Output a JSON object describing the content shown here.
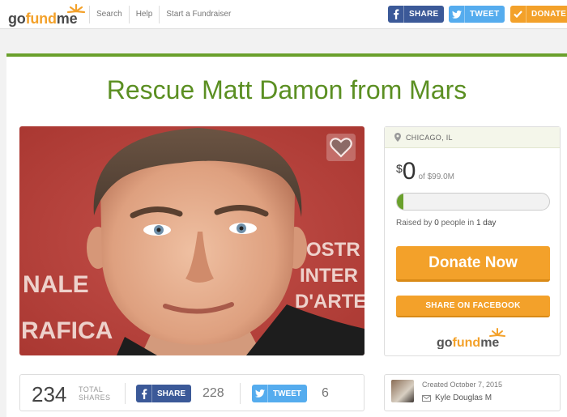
{
  "header": {
    "logo": {
      "go": "go",
      "fund": "fund",
      "me": "me"
    },
    "nav": [
      "Search",
      "Help",
      "Start a Fundraiser"
    ],
    "share_label": "SHARE",
    "tweet_label": "TWEET",
    "donate_label": "DONATE"
  },
  "campaign": {
    "title": "Rescue Matt Damon from Mars",
    "location": "CHICAGO, IL",
    "currency": "$",
    "raised_amount": "0",
    "goal_text": "of $99.0M",
    "progress_fraction": 0.0,
    "raised_by": {
      "prefix": "Raised by ",
      "people": "0",
      "mid": " people in ",
      "days": "1 day"
    },
    "donate_now_label": "Donate Now",
    "share_facebook_label": "SHARE ON FACEBOOK"
  },
  "share_bar": {
    "total": "234",
    "total_label_1": "TOTAL",
    "total_label_2": "SHARES",
    "fb_label": "SHARE",
    "fb_count": "228",
    "tw_label": "TWEET",
    "tw_count": "6"
  },
  "creator": {
    "created": "Created October 7, 2015",
    "name": "Kyle Douglas M"
  },
  "photo": {
    "backdrop_words": [
      "NALE",
      "RAFICA",
      "OSTR",
      "INTER",
      "D'ARTE",
      "ARTE"
    ]
  },
  "colors": {
    "accent_green": "#6aa02c",
    "title_green": "#5b8f22",
    "orange": "#f3a12a",
    "facebook": "#3b5998",
    "twitter": "#55acee"
  }
}
